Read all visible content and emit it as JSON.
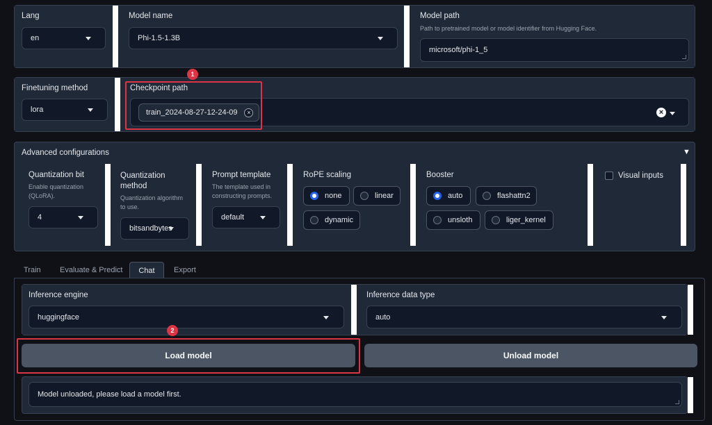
{
  "top": {
    "lang": {
      "label": "Lang",
      "value": "en"
    },
    "model_name": {
      "label": "Model name",
      "value": "Phi-1.5-1.3B"
    },
    "model_path": {
      "label": "Model path",
      "info": "Path to pretrained model or model identifier from Hugging Face.",
      "value": "microsoft/phi-1_5"
    }
  },
  "finetune": {
    "method": {
      "label": "Finetuning method",
      "value": "lora"
    },
    "checkpoint": {
      "label": "Checkpoint path",
      "chip": "train_2024-08-27-12-24-09",
      "chip_remove": "×",
      "clear": "×"
    }
  },
  "advanced": {
    "title": "Advanced configurations",
    "toggle": "▼",
    "quant_bit": {
      "label": "Quantization bit",
      "info": "Enable quantization (QLoRA).",
      "value": "4"
    },
    "quant_method": {
      "label_1": "Quantization",
      "label_2": "method",
      "info_1": "Quantization algorithm",
      "info_2": "to use.",
      "value": "bitsandbytes"
    },
    "prompt_template": {
      "label": "Prompt template",
      "info_1": "The template used in",
      "info_2": "constructing prompts.",
      "value": "default"
    },
    "rope": {
      "label": "RoPE scaling",
      "options": [
        "none",
        "linear",
        "dynamic"
      ],
      "selected": "none"
    },
    "booster": {
      "label": "Booster",
      "options": [
        "auto",
        "flashattn2",
        "unsloth",
        "liger_kernel"
      ],
      "selected": "auto"
    },
    "visual_inputs": {
      "label": "Visual inputs",
      "checked": false
    }
  },
  "tabs": [
    "Train",
    "Evaluate & Predict",
    "Chat",
    "Export"
  ],
  "active_tab": "Chat",
  "chat": {
    "engine": {
      "label": "Inference engine",
      "value": "huggingface"
    },
    "dtype": {
      "label": "Inference data type",
      "value": "auto"
    },
    "load_button": "Load model",
    "unload_button": "Unload model",
    "info_text": "Model unloaded, please load a model first."
  },
  "annotations": {
    "marker_1": "1",
    "marker_2": "2",
    "color": "#dc3545"
  }
}
